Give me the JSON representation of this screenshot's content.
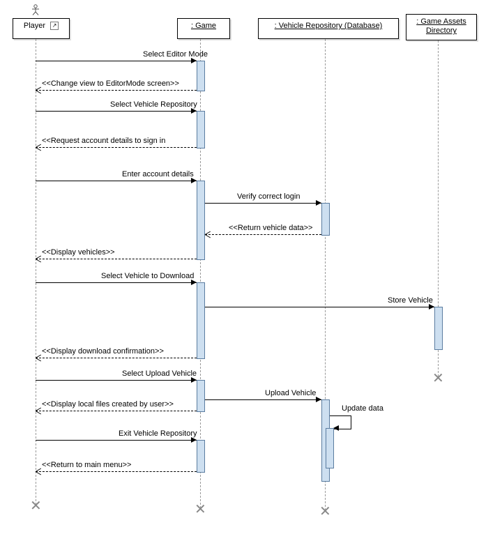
{
  "participants": {
    "player": "Player",
    "game": ": Game",
    "repo": ": Vehicle Repository (Database)",
    "assets": ": Game Assets Directory"
  },
  "messages": {
    "m1": "Select Editor Mode",
    "r1": "<<Change view to EditorMode screen>>",
    "m2": "Select Vehicle Repository",
    "r2": "<<Request account details to sign in",
    "m3": "Enter account details",
    "m3b": "Verify correct login",
    "r3b": "<<Return vehicle data>>",
    "r3": "<<Display vehicles>>",
    "m4": "Select Vehicle to Download",
    "m4b": "Store Vehicle",
    "r4": "<<Display download confirmation>>",
    "m5": "Select Upload Vehicle",
    "m5b": "Upload Vehicle",
    "m5c": "Update data",
    "r5": "<<Display local files created by user>>",
    "m6": "Exit Vehicle Repository",
    "r6": "<<Return to main menu>>"
  }
}
